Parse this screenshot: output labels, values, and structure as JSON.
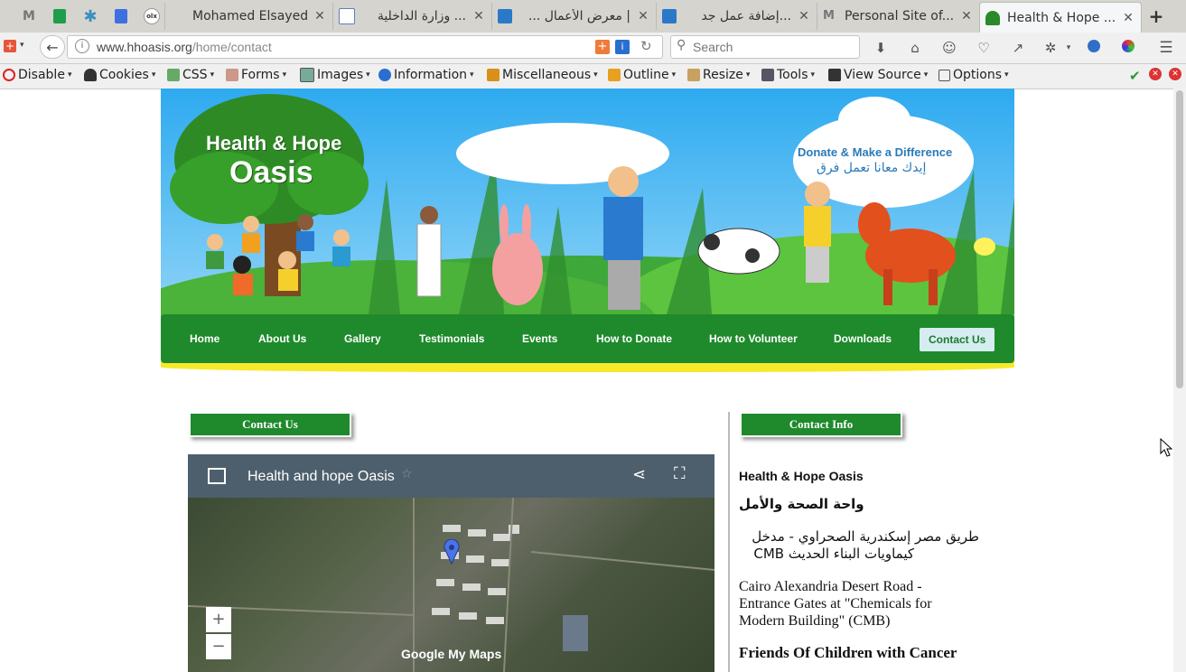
{
  "tabs": [
    {
      "title": "Mohamed Elsayed ...",
      "icon_color": "#c0392b"
    },
    {
      "title": "... وزارة الداخلية",
      "icon_color": "#5b7fc4"
    },
    {
      "title": "| معرض الأعمال ...",
      "icon_color": "#2a79c8"
    },
    {
      "title": "...إضافة عمل جد",
      "icon_color": "#2a79c8"
    },
    {
      "title": "Personal Site of...",
      "icon_color": "#888888"
    },
    {
      "title": "Health & Hope ...",
      "icon_color": "#2a8a2a",
      "active": true
    }
  ],
  "navbar": {
    "url_domain": "www.hhoasis.org",
    "url_path": "/home/contact",
    "search_placeholder": "Search"
  },
  "devtoolbar": {
    "items": [
      "Disable",
      "Cookies",
      "CSS",
      "Forms",
      "Images",
      "Information",
      "Miscellaneous",
      "Outline",
      "Resize",
      "Tools",
      "View Source",
      "Options"
    ]
  },
  "site": {
    "logo_line1": "Health & Hope",
    "logo_line2": "Oasis",
    "donate_en": "Donate & Make a Difference",
    "donate_ar": "إيدك معانا تعمل فرق",
    "menu": [
      "Home",
      "About Us",
      "Gallery",
      "Testimonials",
      "Events",
      "How to Donate",
      "How to Volunteer",
      "Downloads",
      "Contact Us"
    ],
    "active_menu": "Contact Us"
  },
  "contact": {
    "heading": "Contact Us",
    "map_title": "Health and hope Oasis",
    "map_brand": "Google My Maps"
  },
  "info": {
    "heading": "Contact Info",
    "org_en": "Health & Hope Oasis",
    "org_ar": "واحة الصحة والأمل",
    "addr_ar_1": "طريق مصر إسكندرية الصحراوي - مدخل",
    "addr_ar_2": "كيماويات البناء الحديث CMB",
    "addr_en_1": "Cairo Alexandria Desert Road -",
    "addr_en_2": "Entrance Gates at \"Chemicals for",
    "addr_en_3": "Modern Building\" (CMB)",
    "friends": "Friends Of Children with Cancer"
  },
  "colors": {
    "green": "#1e8a2c",
    "sky": "#2eaaf0",
    "yellow": "#f7e92a"
  }
}
